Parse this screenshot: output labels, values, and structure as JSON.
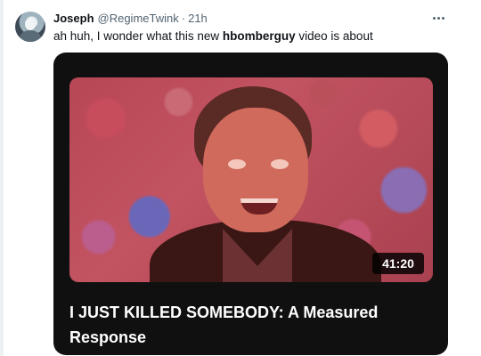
{
  "tweet": {
    "author_name": "Joseph",
    "handle": "@RegimeTwink",
    "separator": "·",
    "time": "21h",
    "text_prefix": "ah huh, I wonder what this new ",
    "text_bold": "hbomberguy",
    "text_suffix": " video is about"
  },
  "video": {
    "duration": "41:20",
    "title": "I JUST KILLED SOMEBODY: A Measured Response"
  },
  "icons": {
    "avatar": "avatar",
    "more": "more-options-icon"
  },
  "colors": {
    "text": "#0f1419",
    "secondary": "#536471",
    "card_bg": "#101010",
    "thumbnail_tint": "#c04d5b"
  }
}
